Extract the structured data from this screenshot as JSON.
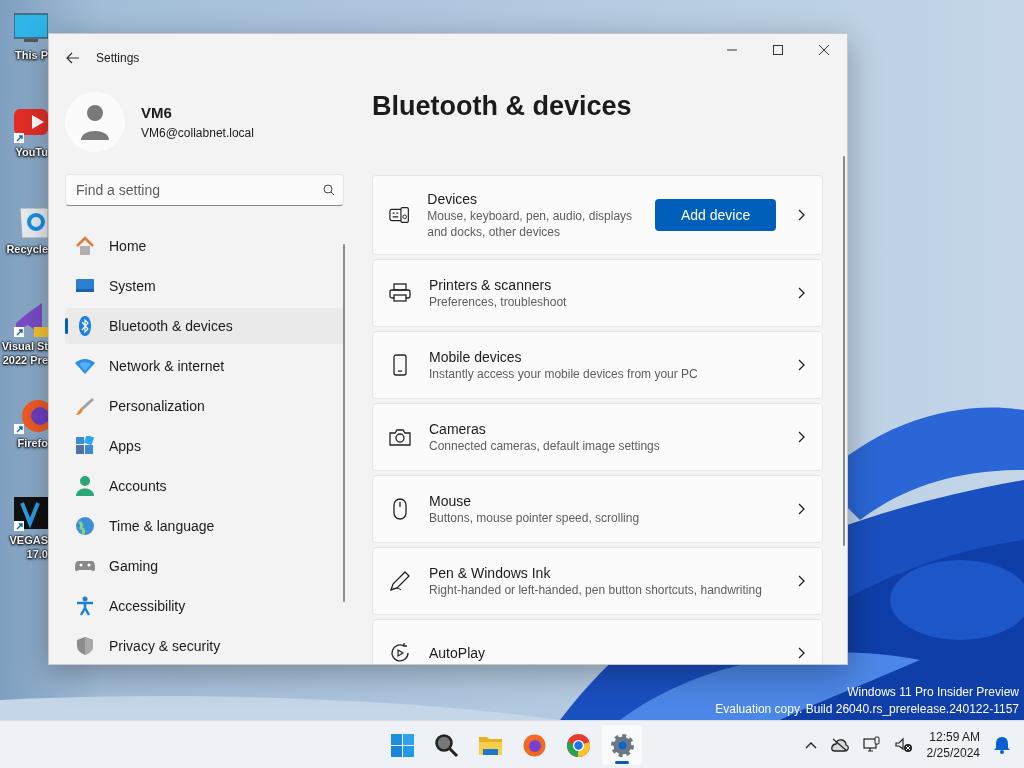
{
  "desktop_icons": [
    {
      "kind": "pc",
      "lines": [
        "This P"
      ]
    },
    {
      "kind": "video",
      "lines": [
        "YouTu"
      ]
    },
    {
      "kind": "recycle",
      "lines": [
        "Recycle"
      ]
    },
    {
      "kind": "ide",
      "lines": [
        "Visual St",
        "2022 Pre"
      ]
    },
    {
      "kind": "browser",
      "lines": [
        "Firefo"
      ]
    },
    {
      "kind": "editor",
      "lines": [
        "VEGAS",
        "17.0"
      ]
    }
  ],
  "window": {
    "title": "Settings",
    "user": {
      "name": "VM6",
      "email": "VM6@collabnet.local"
    },
    "search": {
      "placeholder": "Find a setting"
    },
    "nav": [
      {
        "kind": "home",
        "label": "Home",
        "selected": false
      },
      {
        "kind": "system",
        "label": "System",
        "selected": false
      },
      {
        "kind": "bluetooth",
        "label": "Bluetooth & devices",
        "selected": true
      },
      {
        "kind": "network",
        "label": "Network & internet",
        "selected": false
      },
      {
        "kind": "brush",
        "label": "Personalization",
        "selected": false
      },
      {
        "kind": "apps",
        "label": "Apps",
        "selected": false
      },
      {
        "kind": "accounts",
        "label": "Accounts",
        "selected": false
      },
      {
        "kind": "time",
        "label": "Time & language",
        "selected": false
      },
      {
        "kind": "gaming",
        "label": "Gaming",
        "selected": false
      },
      {
        "kind": "accessibility",
        "label": "Accessibility",
        "selected": false
      },
      {
        "kind": "privacy",
        "label": "Privacy & security",
        "selected": false
      }
    ],
    "heading": "Bluetooth & devices",
    "cards": [
      {
        "kind": "devices",
        "title": "Devices",
        "subtitle": "Mouse, keyboard, pen, audio, displays and docks, other devices",
        "button": "Add device"
      },
      {
        "kind": "printer",
        "title": "Printers & scanners",
        "subtitle": "Preferences, troubleshoot"
      },
      {
        "kind": "phone",
        "title": "Mobile devices",
        "subtitle": "Instantly access your mobile devices from your PC"
      },
      {
        "kind": "camera",
        "title": "Cameras",
        "subtitle": "Connected cameras, default image settings"
      },
      {
        "kind": "mouse",
        "title": "Mouse",
        "subtitle": "Buttons, mouse pointer speed, scrolling"
      },
      {
        "kind": "pen",
        "title": "Pen & Windows Ink",
        "subtitle": "Right-handed or left-handed, pen button shortcuts, handwriting"
      },
      {
        "kind": "autoplay",
        "title": "AutoPlay"
      }
    ]
  },
  "watermark": [
    "Windows 11 Pro Insider Preview",
    "Evaluation copy. Build 26040.rs_prerelease.240122-1157"
  ],
  "taskbar": {
    "apps": [
      {
        "kind": "start",
        "active": false
      },
      {
        "kind": "search",
        "active": false
      },
      {
        "kind": "folder",
        "active": false
      },
      {
        "kind": "browser",
        "active": false
      },
      {
        "kind": "chrome",
        "active": false
      },
      {
        "kind": "settings",
        "active": true
      }
    ],
    "time": "12:59 AM",
    "date": "2/25/2024"
  }
}
